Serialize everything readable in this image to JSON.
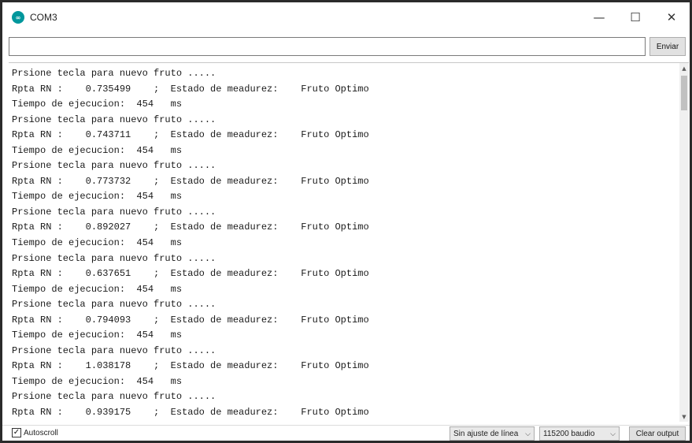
{
  "window": {
    "title": "COM3",
    "app_icon": "arduino-logo-icon",
    "icon_glyph": "∞",
    "minimize_glyph": "—",
    "maximize_glyph": "☐",
    "close_glyph": "✕"
  },
  "send": {
    "input_value": "",
    "button_label": "Enviar"
  },
  "output": {
    "lines": [
      "Prsione tecla para nuevo fruto .....",
      "Rpta RN :    0.735499    ;  Estado de meadurez:    Fruto Optimo",
      "Tiempo de ejecucion:  454   ms",
      "Prsione tecla para nuevo fruto .....",
      "Rpta RN :    0.743711    ;  Estado de meadurez:    Fruto Optimo",
      "Tiempo de ejecucion:  454   ms",
      "Prsione tecla para nuevo fruto .....",
      "Rpta RN :    0.773732    ;  Estado de meadurez:    Fruto Optimo",
      "Tiempo de ejecucion:  454   ms",
      "Prsione tecla para nuevo fruto .....",
      "Rpta RN :    0.892027    ;  Estado de meadurez:    Fruto Optimo",
      "Tiempo de ejecucion:  454   ms",
      "Prsione tecla para nuevo fruto .....",
      "Rpta RN :    0.637651    ;  Estado de meadurez:    Fruto Optimo",
      "Tiempo de ejecucion:  454   ms",
      "Prsione tecla para nuevo fruto .....",
      "Rpta RN :    0.794093    ;  Estado de meadurez:    Fruto Optimo",
      "Tiempo de ejecucion:  454   ms",
      "Prsione tecla para nuevo fruto .....",
      "Rpta RN :    1.038178    ;  Estado de meadurez:    Fruto Optimo",
      "Tiempo de ejecucion:  454   ms",
      "Prsione tecla para nuevo fruto .....",
      "Rpta RN :    0.939175    ;  Estado de meadurez:    Fruto Optimo"
    ]
  },
  "footer": {
    "autoscroll_label": "Autoscroll",
    "autoscroll_checked": true,
    "check_glyph": "✓",
    "line_ending": "Sin ajuste de línea",
    "baud_rate": "115200 baudio",
    "chevron_glyph": "⌵",
    "clear_label": "Clear output"
  },
  "scrollbar": {
    "up_glyph": "▲",
    "down_glyph": "▼"
  }
}
